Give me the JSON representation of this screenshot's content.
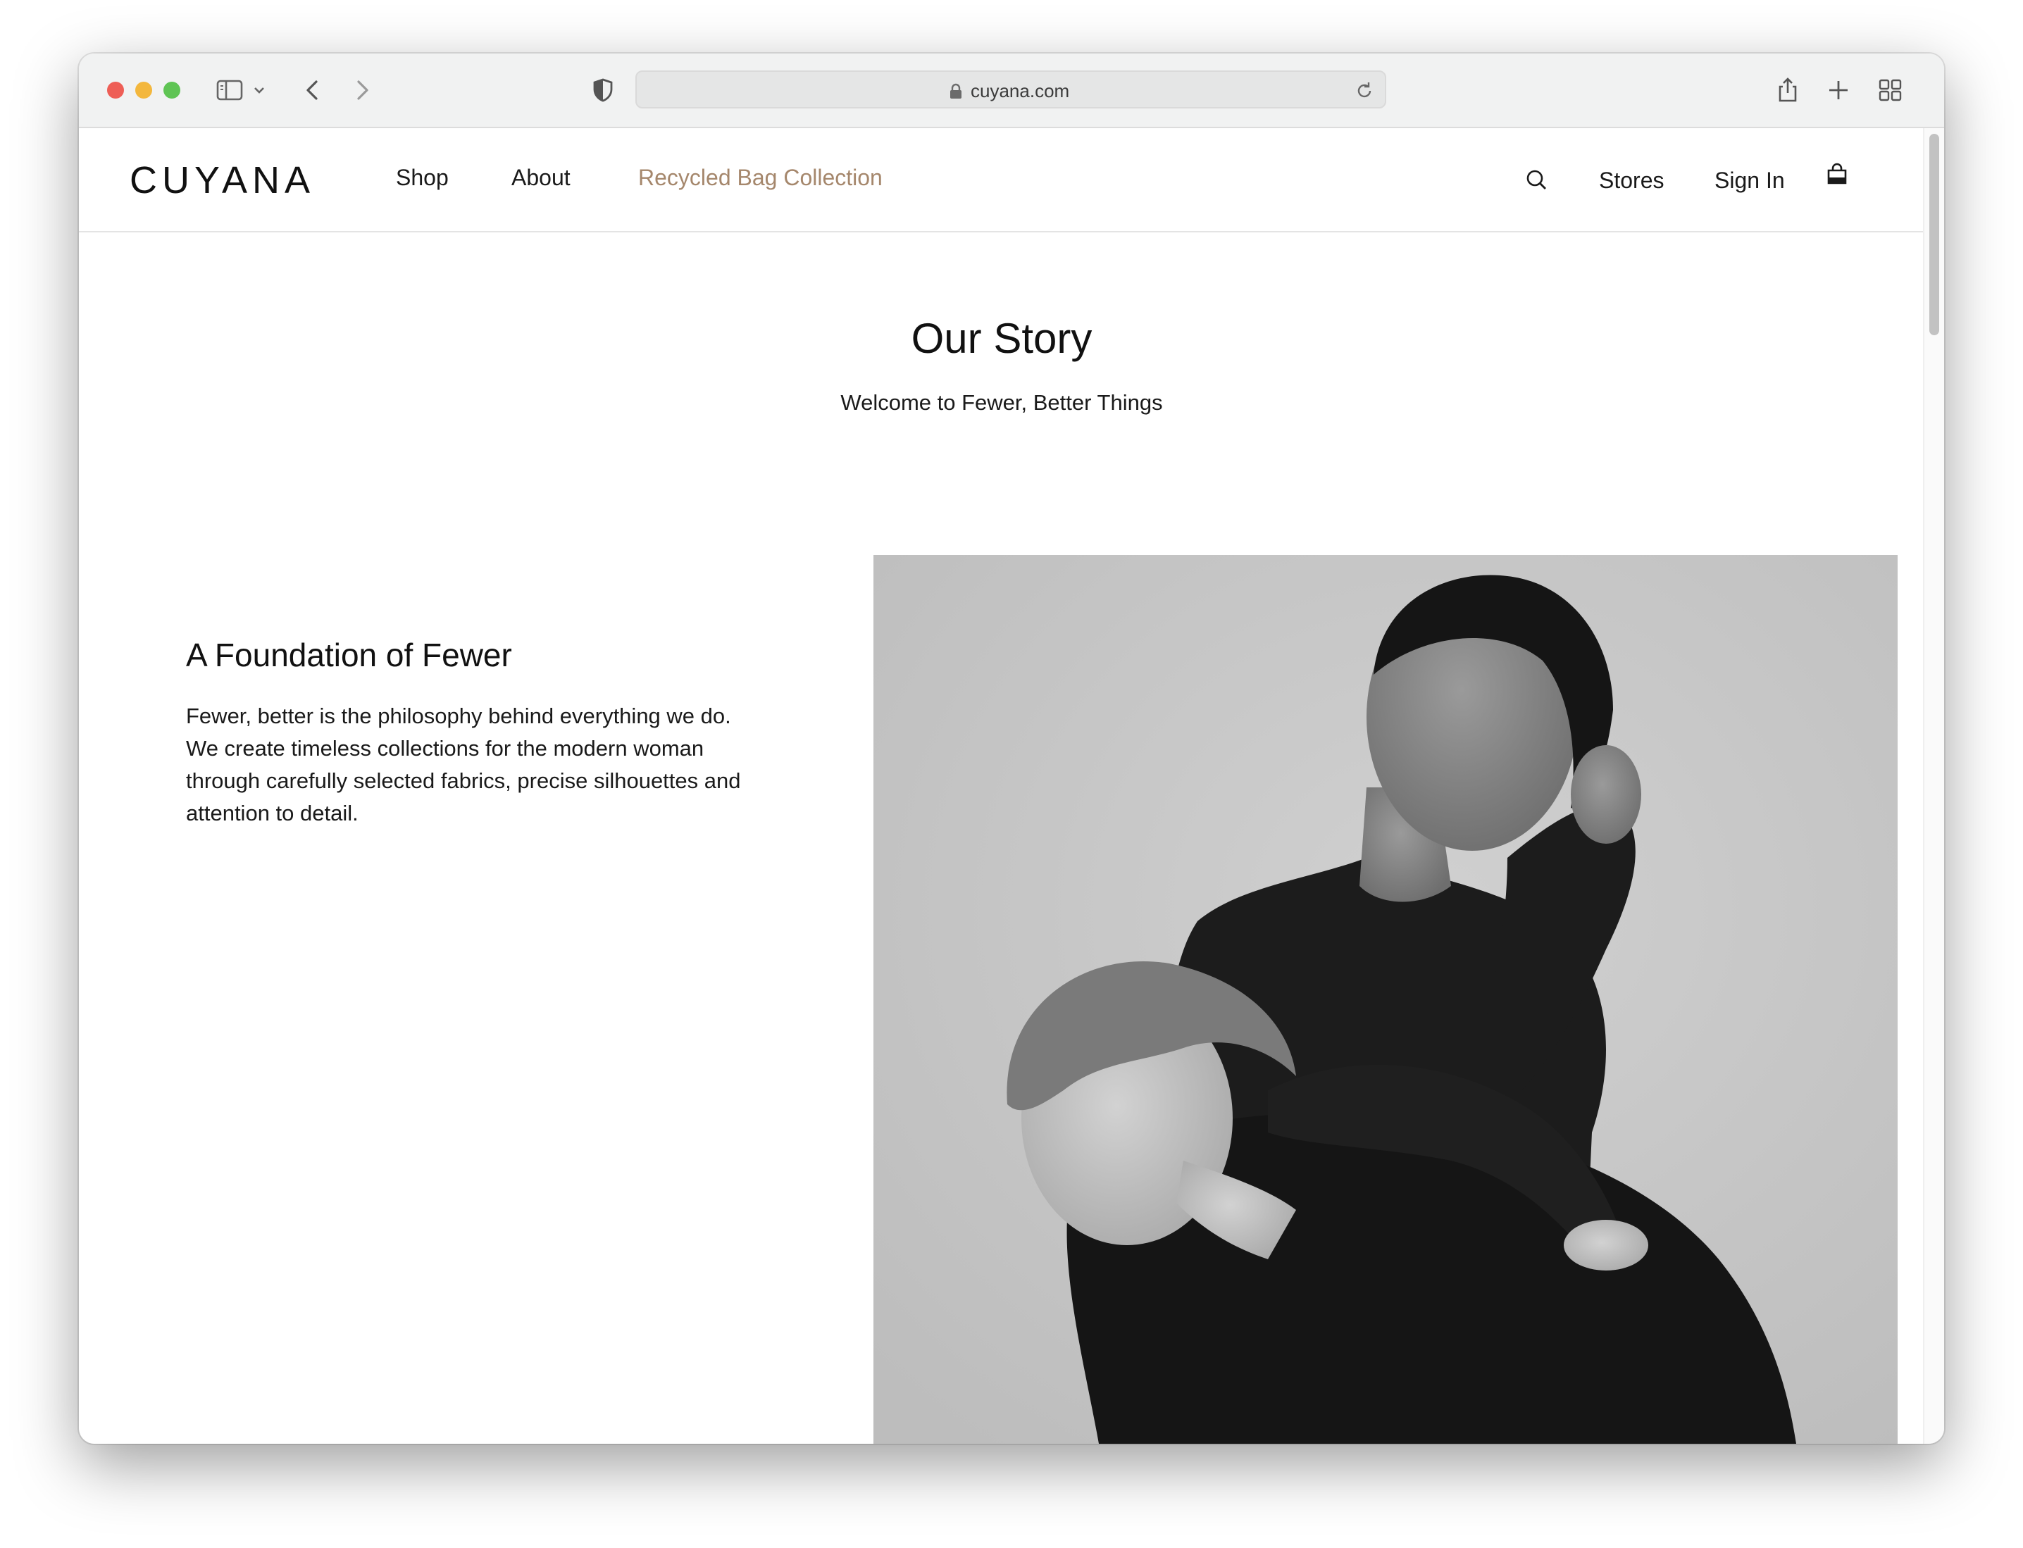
{
  "browser": {
    "url": "cuyana.com"
  },
  "site": {
    "logo": "CUYANA",
    "nav": {
      "shop": "Shop",
      "about": "About",
      "recycled": "Recycled Bag Collection"
    },
    "header_right": {
      "stores": "Stores",
      "sign_in": "Sign In"
    },
    "accent_color": "#a5876c"
  },
  "hero": {
    "title": "Our Story",
    "subtitle": "Welcome to Fewer, Better Things"
  },
  "section": {
    "heading": "A Foundation of Fewer",
    "body": "Fewer, better is the philosophy behind everything we do. We create timeless collections for the modern woman through carefully selected fabrics, precise silhouettes and attention to detail."
  },
  "icons": {
    "sidebar": "sidebar-icon",
    "back": "chevron-left-icon",
    "forward": "chevron-right-icon",
    "privacy": "shield-icon",
    "lock": "lock-icon",
    "reload": "reload-icon",
    "share": "share-icon",
    "new_tab": "plus-icon",
    "tabs": "tab-overview-icon",
    "search": "search-icon",
    "bag": "shopping-bag-icon"
  }
}
